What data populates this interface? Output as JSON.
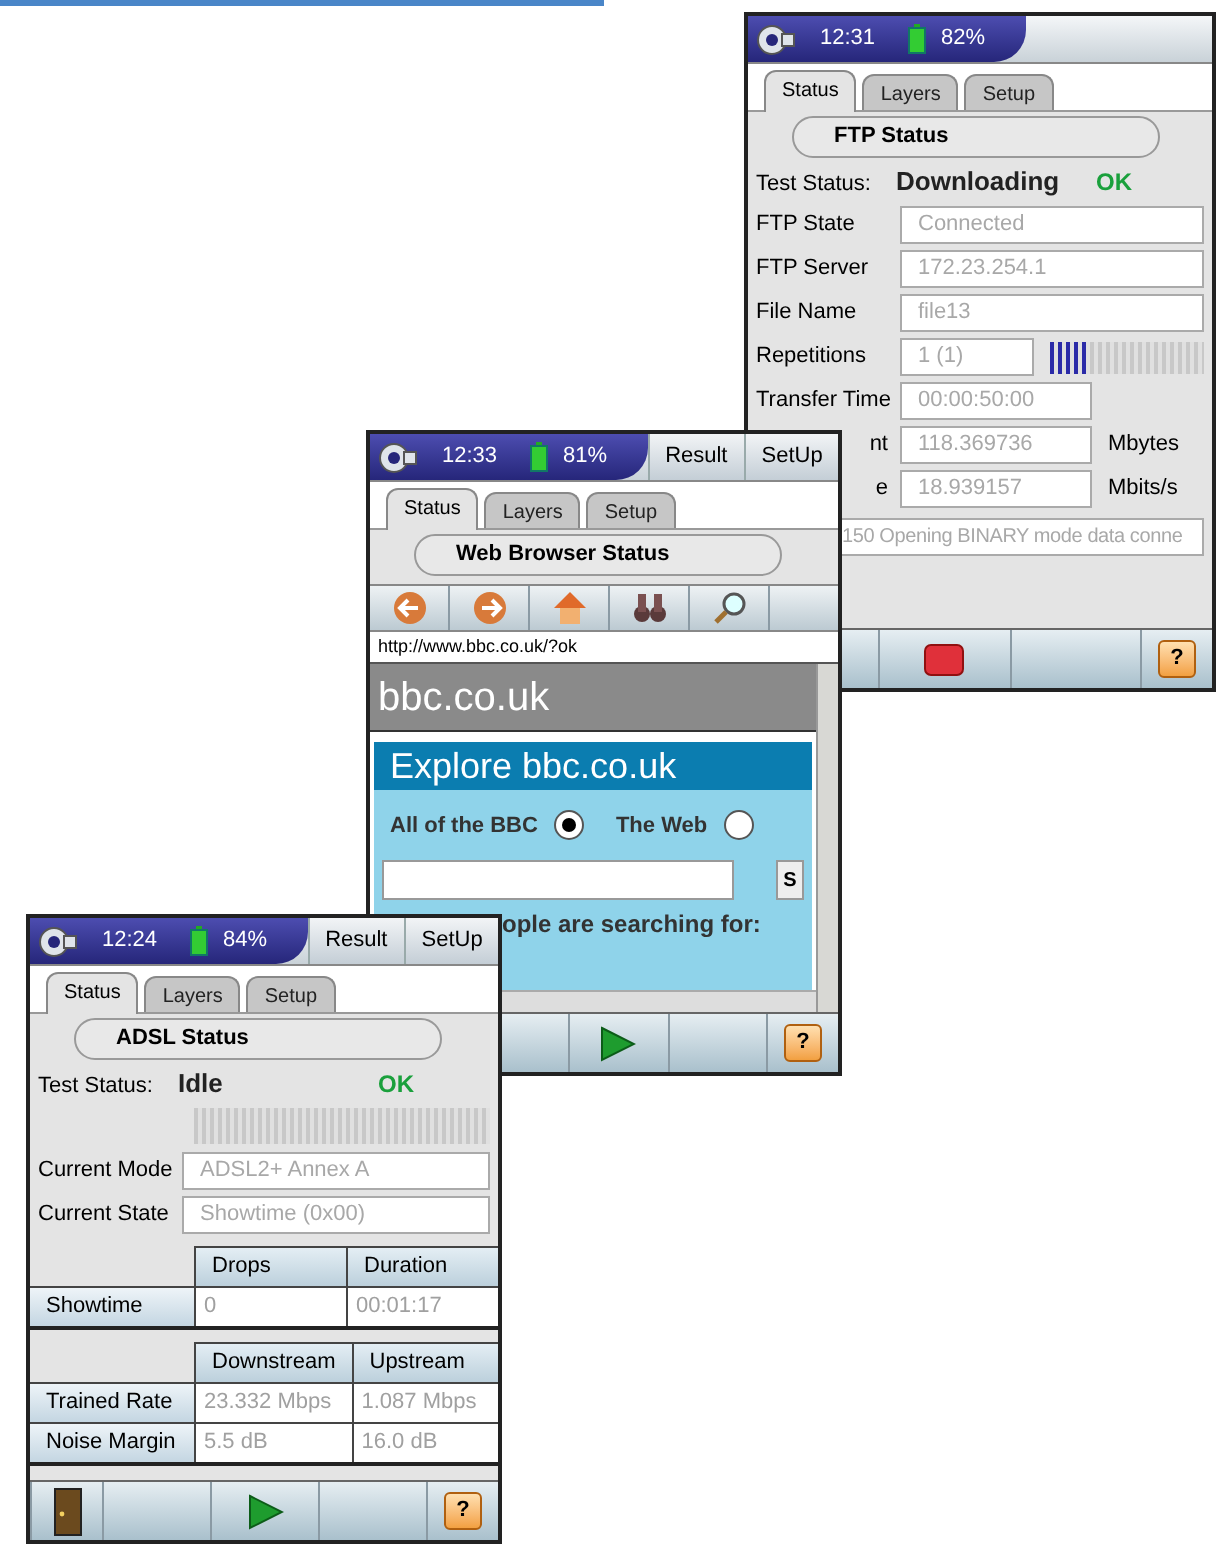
{
  "windows": [
    {
      "kind": "ftp",
      "status": {
        "time": "12:31",
        "battery": "82%"
      },
      "tabs": [
        {
          "label": "Status",
          "selected": true
        },
        {
          "label": "Layers",
          "selected": false
        },
        {
          "label": "Setup",
          "selected": false
        }
      ],
      "panel_title": "FTP Status",
      "test_status": {
        "label": "Test Status:",
        "value": "Downloading",
        "result": "OK"
      },
      "fields": [
        {
          "kind": "wide",
          "label": "FTP State",
          "value": "Connected"
        },
        {
          "kind": "wide",
          "label": "FTP Server",
          "value": "172.23.254.1"
        },
        {
          "kind": "wide",
          "label": "File Name",
          "value": "file13"
        },
        {
          "kind": "meter",
          "label": "Repetitions",
          "value": "1 (1)",
          "level": 0.25
        },
        {
          "kind": "medium",
          "label": "Transfer Time",
          "value": "00:00:50:00"
        },
        {
          "kind": "medium",
          "label": "nt",
          "value": "118.369736",
          "unit": "Mbytes"
        },
        {
          "kind": "medium",
          "label": "e",
          "value": "18.939157",
          "unit": "Mbits/s"
        }
      ],
      "message": "150 Opening BINARY mode data conne",
      "toolbar": [
        {
          "kind": "blank"
        },
        {
          "kind": "stop"
        },
        {
          "kind": "blank"
        },
        {
          "kind": "help",
          "label": "?"
        }
      ]
    },
    {
      "kind": "web",
      "status": {
        "time": "12:33",
        "battery": "81%"
      },
      "header_buttons": [
        "Result",
        "SetUp"
      ],
      "tabs": [
        {
          "label": "Status",
          "selected": true
        },
        {
          "label": "Layers",
          "selected": false
        },
        {
          "label": "Setup",
          "selected": false
        }
      ],
      "panel_title": "Web Browser Status",
      "nav": [
        {
          "kind": "back"
        },
        {
          "kind": "forward"
        },
        {
          "kind": "home"
        },
        {
          "kind": "binoculars"
        },
        {
          "kind": "search"
        }
      ],
      "url": "http://www.bbc.co.uk/?ok",
      "page": {
        "site": "bbc.co.uk",
        "banner": "Explore bbc.co.uk",
        "radios": [
          {
            "label": "All of the BBC",
            "selected": true
          },
          {
            "label": "The Web",
            "selected": false
          }
        ],
        "search_button": "S",
        "caption": "ople are searching for:"
      },
      "toolbar": [
        {
          "kind": "blank"
        },
        {
          "kind": "blank"
        },
        {
          "kind": "play"
        },
        {
          "kind": "blank"
        },
        {
          "kind": "help",
          "label": "?"
        }
      ]
    },
    {
      "kind": "adsl",
      "status": {
        "time": "12:24",
        "battery": "84%"
      },
      "header_buttons": [
        "Result",
        "SetUp"
      ],
      "tabs": [
        {
          "label": "Status",
          "selected": true
        },
        {
          "label": "Layers",
          "selected": false
        },
        {
          "label": "Setup",
          "selected": false
        }
      ],
      "panel_title": "ADSL Status",
      "test_status": {
        "label": "Test Status:",
        "value": "Idle",
        "result": "OK"
      },
      "meter": {
        "level": 0
      },
      "fields": [
        {
          "kind": "wide",
          "label": "Current Mode",
          "value": "ADSL2+  Annex A"
        },
        {
          "kind": "wide",
          "label": "Current State",
          "value": "Showtime  (0x00)"
        }
      ],
      "tables": [
        {
          "columns": [
            "Drops",
            "Duration"
          ],
          "rows": [
            {
              "label": "Showtime",
              "cells": [
                "0",
                "00:01:17"
              ]
            }
          ]
        },
        {
          "columns": [
            "Downstream",
            "Upstream"
          ],
          "rows": [
            {
              "label": "Trained Rate",
              "cells": [
                "23.332 Mbps",
                "1.087 Mbps"
              ]
            },
            {
              "label": "Noise Margin",
              "cells": [
                "5.5 dB",
                "16.0 dB"
              ]
            }
          ]
        }
      ],
      "toolbar": [
        {
          "kind": "exit"
        },
        {
          "kind": "blank"
        },
        {
          "kind": "play"
        },
        {
          "kind": "blank"
        },
        {
          "kind": "help",
          "label": "?"
        }
      ]
    }
  ]
}
